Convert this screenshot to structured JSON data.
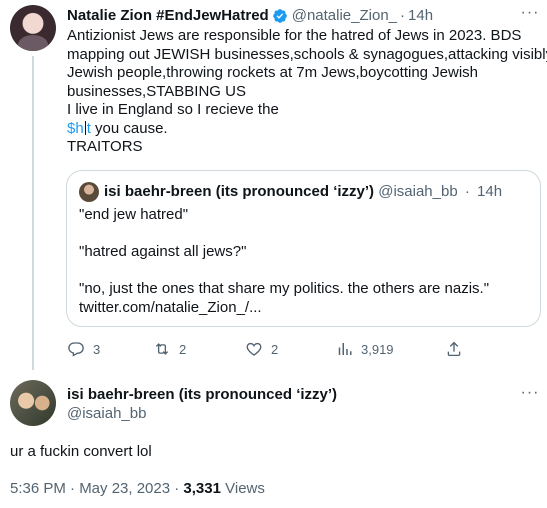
{
  "main_tweet": {
    "author_name": "Natalie Zion #EndJewHatred",
    "handle": "@natalie_Zion_",
    "separator": "·",
    "time": "14h",
    "more_label": "···",
    "body_lines": [
      "Antizionist Jews are responsible for the hatred of Jews in 2023. BDS",
      "mapping out JEWISH businesses,schools & synagogues,attacking visibly",
      "Jewish people,throwing rockets at 7m Jews,boycotting Jewish",
      "businesses,STABBING US",
      "I live in England so I recieve the"
    ],
    "link_before_cursor": "$h",
    "link_after_cursor": "t",
    "after_link": " you cause.",
    "last_line": "TRAITORS",
    "quoted": {
      "author_name": "isi baehr-breen (its pronounced ‘izzy’)",
      "handle": "@isaiah_bb",
      "separator": "·",
      "time": "14h",
      "paragraphs": [
        "\"end jew hatred\"",
        "\"hatred against all jews?\"",
        "\"no, just the ones that share my politics. the others are nazis.\""
      ],
      "link_text": "twitter.com/natalie_Zion_/..."
    },
    "actions": {
      "reply_count": "3",
      "retweet_count": "2",
      "like_count": "2",
      "views_count": "3,919"
    }
  },
  "reply_tweet": {
    "author_name": "isi baehr-breen (its pronounced ‘izzy’)",
    "handle": "@isaiah_bb",
    "more_label": "···",
    "body": "ur a fuckin convert lol",
    "timestamp": "5:36 PM · May 23, 2023 · ",
    "views_count": "3,331",
    "views_label": " Views"
  },
  "colors": {
    "text": "#0f1419",
    "secondary": "#536471",
    "link": "#1d9bf0",
    "border": "#cfd9de",
    "verified": "#1d9bf0"
  }
}
